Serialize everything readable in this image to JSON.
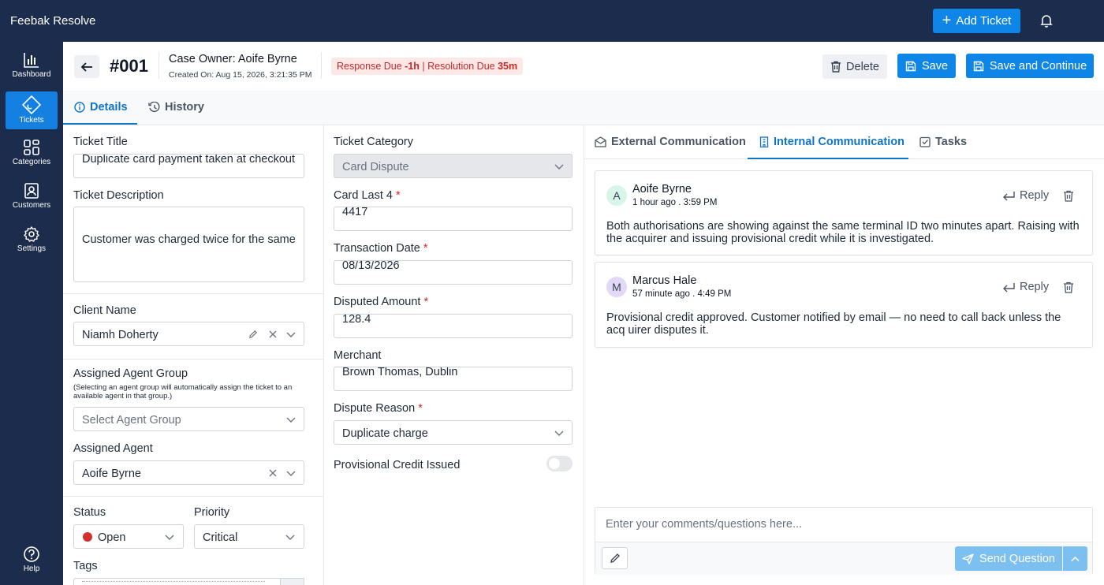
{
  "topbar": {
    "app_name": "Feebak Resolve",
    "add_ticket_label": "Add Ticket"
  },
  "sidebar": {
    "items": [
      {
        "label": "Dashboard",
        "icon": "bar-chart-icon"
      },
      {
        "label": "Tickets",
        "icon": "ticket-icon",
        "active": true
      },
      {
        "label": "Categories",
        "icon": "grid-icon"
      },
      {
        "label": "Customers",
        "icon": "contact-card-icon"
      },
      {
        "label": "Settings",
        "icon": "gear-icon"
      }
    ],
    "help_label": "Help"
  },
  "header": {
    "ticket_number": "#001",
    "case_owner": "Case Owner: Aoife Byrne",
    "created_on": "Created On: Aug 15, 2026, 3:21:35 PM",
    "sla": {
      "response_prefix": "Response Due ",
      "response_value": "-1h",
      "separator": " | ",
      "resolution_prefix": "Resolution Due ",
      "resolution_value": "35m"
    },
    "delete_label": "Delete",
    "save_label": "Save",
    "save_continue_label": "Save and Continue"
  },
  "tabs": {
    "details": "Details",
    "history": "History",
    "active": "Details"
  },
  "form": {
    "ticket_title": {
      "label": "Ticket Title",
      "value": "Duplicate card payment taken at checkout"
    },
    "ticket_description": {
      "label": "Ticket Description",
      "value": "Customer was charged twice for the same"
    },
    "client_name": {
      "label": "Client Name",
      "value": "Niamh Doherty"
    },
    "assigned_agent_group": {
      "label": "Assigned Agent Group",
      "hint": "(Selecting an agent group will automatically assign the ticket to an available agent in that group.)",
      "placeholder": "Select Agent Group"
    },
    "assigned_agent": {
      "label": "Assigned Agent",
      "value": "Aoife Byrne"
    },
    "status": {
      "label": "Status",
      "value": "Open",
      "color": "#d32f2f"
    },
    "priority": {
      "label": "Priority",
      "value": "Critical"
    },
    "tags": {
      "label": "Tags"
    },
    "ticket_category": {
      "label": "Ticket Category",
      "value": "Card Dispute"
    },
    "card_last4": {
      "label": "Card Last 4",
      "required": "*",
      "value": "4417"
    },
    "transaction_date": {
      "label": "Transaction Date",
      "required": "*",
      "value": "08/13/2026"
    },
    "disputed_amount": {
      "label": "Disputed Amount",
      "required": "*",
      "value": "128.4"
    },
    "merchant": {
      "label": "Merchant",
      "value": "Brown Thomas, Dublin"
    },
    "dispute_reason": {
      "label": "Dispute Reason",
      "required": "*",
      "value": "Duplicate charge"
    },
    "provisional_credit": {
      "label": "Provisional Credit Issued",
      "enabled": false
    }
  },
  "comm_tabs": {
    "external": "External Communication",
    "internal": "Internal Communication",
    "tasks": "Tasks",
    "active": "Internal Communication"
  },
  "messages": [
    {
      "initial": "A",
      "author": "Aoife Byrne",
      "ago": "1 hour ago",
      "time": "3:59 PM",
      "text": "Both authorisations are showing against the same terminal ID two minutes apart. Raising with the acquirer and issuing provisional credit while it is investigated.",
      "avatar_color": "#d7f5e9",
      "reply_label": "Reply"
    },
    {
      "initial": "M",
      "author": "Marcus Hale",
      "ago": "57 minute ago",
      "time": "4:49 PM",
      "text": "Provisional credit approved. Customer notified by email — no need to call back unless the acq uirer disputes it.",
      "avatar_color": "#e1d9f7",
      "reply_label": "Reply"
    }
  ],
  "compose": {
    "placeholder": "Enter your comments/questions here...",
    "send_label": "Send Question"
  },
  "meta_separator": "."
}
